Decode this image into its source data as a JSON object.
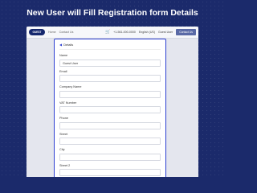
{
  "banner": {
    "title": "New User will Fill Registration form Details"
  },
  "topbar": {
    "logo_text": "GUEST",
    "nav": [
      "Home",
      "Contact Us"
    ],
    "phone": "+1-561-000-0000",
    "language": "English (US)",
    "user": "Guest User",
    "contact_button": "Contact Us"
  },
  "form": {
    "back_label": "Details",
    "fields": [
      {
        "label": "Name",
        "value": "Guest User"
      },
      {
        "label": "Email",
        "value": ""
      },
      {
        "label": "Company Name",
        "value": ""
      },
      {
        "label": "VAT Number",
        "value": ""
      },
      {
        "label": "Phone",
        "value": ""
      },
      {
        "label": "Street",
        "value": ""
      },
      {
        "label": "City",
        "value": ""
      },
      {
        "label": "Street 2",
        "value": ""
      }
    ]
  },
  "colors": {
    "background": "#1b2a6b",
    "form_border": "#2d3fd1",
    "logo": "#16286e"
  },
  "icons": {
    "cart": "cart-icon",
    "back": "back-arrow-icon"
  }
}
